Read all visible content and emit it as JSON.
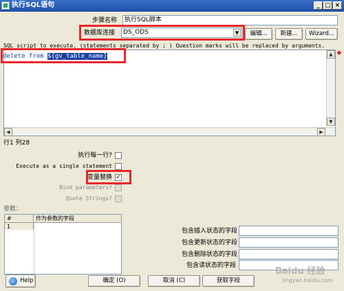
{
  "window": {
    "title": "执行SQL语句",
    "controls": [
      "_",
      "□",
      "×"
    ]
  },
  "step": {
    "label": "步骤名称",
    "value": "执行SQL脚本"
  },
  "connection": {
    "label": "数据库连接",
    "value": "DS_ODS",
    "edit_label": "编辑...",
    "new_label": "新建...",
    "wizard_label": "Wizard..."
  },
  "sql": {
    "hint": "SQL script to execute. (statements separated by ; ) Question marks will be replaced by arguments.",
    "prefix": "delete from ",
    "variable": "${gv_table_name}"
  },
  "cursor_pos": "行1 列28",
  "options": {
    "execute_each_row": "执行每一行?",
    "single_statement": "Execute as a single statement",
    "variable_substitution": "变量替换",
    "bind_parameters": "Bind parameters?",
    "quote_strings": "Quote Strings?",
    "variable_substitution_checked": true
  },
  "params": {
    "label": "参数：",
    "columns": [
      "#",
      "作为参数的字段"
    ],
    "rows": [
      [
        "1",
        ""
      ]
    ]
  },
  "status_fields": {
    "insert": "包含插入状态的字段",
    "update": "包含更新状态的字段",
    "delete": "包含删除状态的字段",
    "read": "包含读状态的字段"
  },
  "footer": {
    "help": "Help",
    "ok": "确定 (O)",
    "cancel": "取消 (C)",
    "get_fields": "获取字段"
  },
  "watermark": {
    "brand": "Baidu 经验",
    "url": "jingyan.baidu.com"
  },
  "colors": {
    "title_bar": "#1d4fa8",
    "highlight": "#e8262b",
    "sql_text": "#1a3fa0"
  }
}
